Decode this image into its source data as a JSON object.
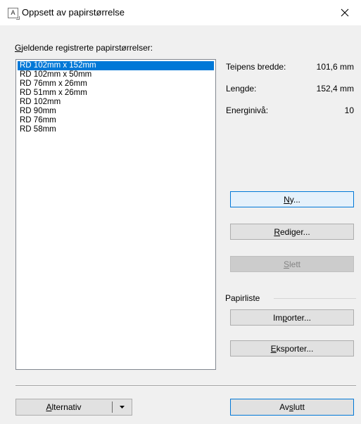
{
  "window": {
    "title": "Oppsett av papirstørrelse",
    "icon_letter": "A"
  },
  "list": {
    "label_first": "G",
    "label_rest": "jeldende registrerte papirstørrelser:",
    "items": [
      "RD 102mm x 152mm",
      "RD 102mm x 50mm",
      "RD 76mm x 26mm",
      "RD 51mm x 26mm",
      "RD 102mm",
      "RD 90mm",
      "RD 76mm",
      "RD 58mm"
    ],
    "selected_index": 0
  },
  "info": {
    "width_label": "Teipens bredde:",
    "width_value": "101,6 mm",
    "length_label": "Lengde:",
    "length_value": "152,4 mm",
    "energy_label": "Energinivå:",
    "energy_value": "10"
  },
  "buttons": {
    "new_first": "N",
    "new_rest": "y...",
    "edit_first": "R",
    "edit_rest": "ediger...",
    "delete_first": "S",
    "delete_rest": "lett",
    "import_pre": "Im",
    "import_ul": "p",
    "import_post": "orter...",
    "export_first": "E",
    "export_rest": "ksporter...",
    "options_first": "A",
    "options_rest": "lternativ",
    "close_pre": "Av",
    "close_ul": "s",
    "close_post": "lutt"
  },
  "group": {
    "paper_list_label": "Papirliste"
  }
}
